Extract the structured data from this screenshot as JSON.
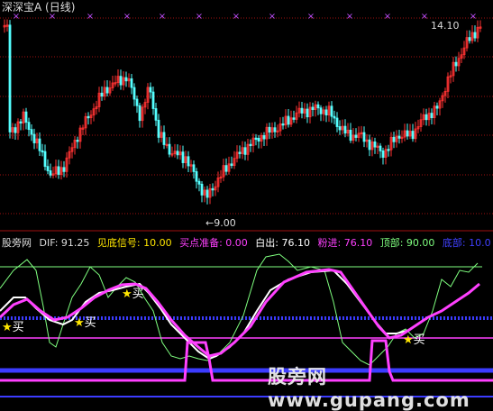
{
  "header": {
    "title": "深深宝A (日线)"
  },
  "price_chart": {
    "high_annotation": "14.10",
    "low_annotation": "←9.00",
    "xmark": "×"
  },
  "indicator": {
    "name": "股旁网",
    "dif": "DIF: 91.25",
    "signal": "见底信号: 10.00",
    "buy_ready": "买点准备: 0.00",
    "out": "白出: 76.10",
    "pink_in": "粉进: 76.10",
    "top": "顶部: 90.00",
    "bottom": "底部: 10.0"
  },
  "buy_signals": [
    {
      "star": "★",
      "text": "买"
    },
    {
      "star": "★",
      "text": "买"
    },
    {
      "star": "★",
      "text": "买"
    },
    {
      "star": "★",
      "text": "买"
    }
  ],
  "watermark": {
    "text": "股旁网 www.gupang.com"
  },
  "colors": {
    "up": "#ff3232",
    "down": "#54ffff",
    "grid": "#a01010",
    "pink": "#ff40ff",
    "white": "#ffffff",
    "green": "#7fff7f",
    "blue": "#3c3cff",
    "yellow": "#ffe600",
    "magenta_x": "#c050ff"
  },
  "chart_data": {
    "type": "candlestick",
    "title": "深深宝A (日线)",
    "price_high": 14.1,
    "price_low": 9.0,
    "indicator_levels": {
      "top": 90.0,
      "bottom": 10.0
    },
    "indicator_values": {
      "DIF": 91.25,
      "见底信号": 10.0,
      "买点准备": 0.0,
      "白出": 76.1,
      "粉进": 76.1
    }
  }
}
